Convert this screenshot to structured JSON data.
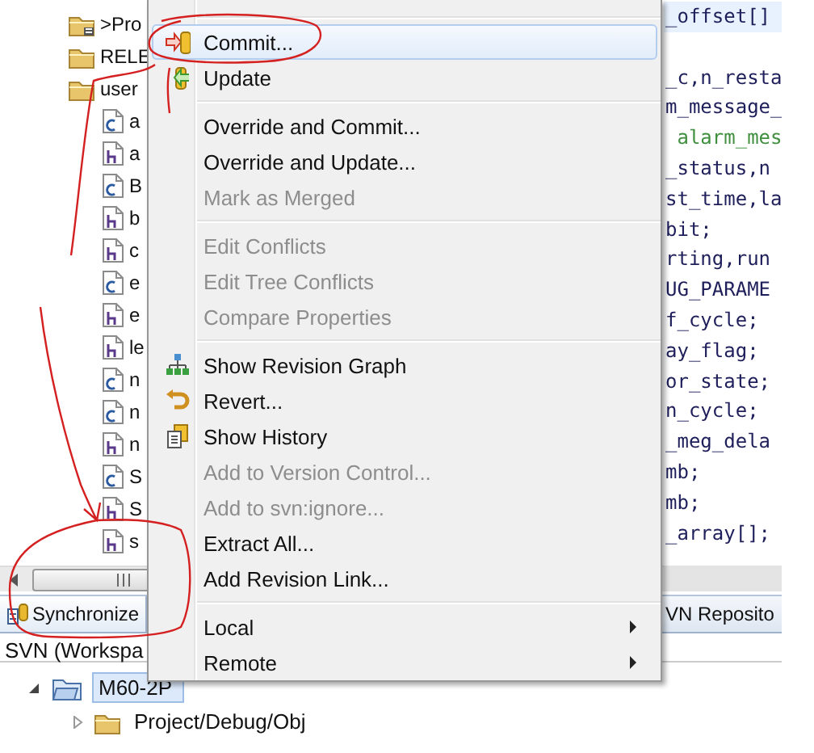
{
  "tree": {
    "items": [
      {
        "label": ">Pro",
        "kind": "folder-modified"
      },
      {
        "label": "RELE",
        "kind": "folder"
      },
      {
        "label": "user",
        "kind": "folder",
        "children": [
          {
            "label": "a",
            "kind": "c"
          },
          {
            "label": "a",
            "kind": "h"
          },
          {
            "label": "B",
            "kind": "c"
          },
          {
            "label": "b",
            "kind": "h"
          },
          {
            "label": "c",
            "kind": "h"
          },
          {
            "label": "e",
            "kind": "c"
          },
          {
            "label": "e",
            "kind": "h"
          },
          {
            "label": "le",
            "kind": "h"
          },
          {
            "label": "n",
            "kind": "c"
          },
          {
            "label": "n",
            "kind": "c"
          },
          {
            "label": "n",
            "kind": "h"
          },
          {
            "label": "S",
            "kind": "c"
          },
          {
            "label": "S",
            "kind": "h"
          },
          {
            "label": "s",
            "kind": "h"
          }
        ]
      }
    ]
  },
  "editor": {
    "lines": [
      {
        "kind": "code",
        "text": "_offset[]",
        "current": true
      },
      {
        "kind": "blank",
        "current": false
      },
      {
        "kind": "code",
        "text": "_c,n_resta",
        "current": false
      },
      {
        "kind": "code",
        "text": "m_message_",
        "current": false
      },
      {
        "kind": "comment",
        "text": " alarm_mes",
        "current": false
      },
      {
        "kind": "code",
        "text": "_status,n",
        "current": false
      },
      {
        "kind": "code",
        "text": "st_time,la",
        "current": false
      },
      {
        "kind": "code",
        "text": "bit;",
        "current": false
      },
      {
        "kind": "code",
        "text": "rting,run",
        "current": false
      },
      {
        "kind": "code",
        "text": "UG_PARAME",
        "current": false
      },
      {
        "kind": "code",
        "text": "f_cycle;",
        "current": false
      },
      {
        "kind": "code",
        "text": "ay_flag;",
        "current": false
      },
      {
        "kind": "code",
        "text": "or_state;",
        "current": false
      },
      {
        "kind": "code",
        "text": "n_cycle;",
        "current": false
      },
      {
        "kind": "code",
        "text": "_meg_dela",
        "current": false
      },
      {
        "kind": "code",
        "text": "mb;",
        "current": false
      },
      {
        "kind": "code",
        "text": "mb;",
        "current": false
      },
      {
        "kind": "code",
        "text": "_array[];",
        "current": false
      }
    ]
  },
  "tabs": [
    {
      "label": "Synchronize",
      "selected": true
    },
    {
      "label": "VN Reposito",
      "selected": false
    }
  ],
  "sync_view": {
    "title": "SVN (Workspa",
    "items": [
      {
        "label": "M60-2P",
        "selected": true,
        "expanded": true,
        "children": [
          {
            "label": "Project/Debug/Obj",
            "selected": false,
            "expanded": false
          }
        ]
      }
    ]
  },
  "context_menu": {
    "items": [
      {
        "kind": "separator"
      },
      {
        "kind": "commit",
        "label": "Commit...",
        "selected": true,
        "disabled": false,
        "submenu": false
      },
      {
        "kind": "update",
        "label": "Update",
        "selected": false,
        "disabled": false,
        "submenu": false
      },
      {
        "kind": "separator"
      },
      {
        "kind": "plain",
        "label": "Override and Commit...",
        "selected": false,
        "disabled": false,
        "submenu": false
      },
      {
        "kind": "plain",
        "label": "Override and Update...",
        "selected": false,
        "disabled": false,
        "submenu": false
      },
      {
        "kind": "plain",
        "label": "Mark as Merged",
        "selected": false,
        "disabled": true,
        "submenu": false
      },
      {
        "kind": "separator"
      },
      {
        "kind": "plain",
        "label": "Edit Conflicts",
        "selected": false,
        "disabled": true,
        "submenu": false
      },
      {
        "kind": "plain",
        "label": "Edit Tree Conflicts",
        "selected": false,
        "disabled": true,
        "submenu": false
      },
      {
        "kind": "plain",
        "label": "Compare Properties",
        "selected": false,
        "disabled": true,
        "submenu": false
      },
      {
        "kind": "separator"
      },
      {
        "kind": "graph",
        "label": "Show Revision Graph",
        "selected": false,
        "disabled": false,
        "submenu": false
      },
      {
        "kind": "revert",
        "label": "Revert...",
        "selected": false,
        "disabled": false,
        "submenu": false
      },
      {
        "kind": "history",
        "label": "Show History",
        "selected": false,
        "disabled": false,
        "submenu": false
      },
      {
        "kind": "plain",
        "label": "Add to Version Control...",
        "selected": false,
        "disabled": true,
        "submenu": false
      },
      {
        "kind": "plain",
        "label": "Add to svn:ignore...",
        "selected": false,
        "disabled": true,
        "submenu": false
      },
      {
        "kind": "plain",
        "label": "Extract All...",
        "selected": false,
        "disabled": false,
        "submenu": false
      },
      {
        "kind": "plain",
        "label": "Add Revision Link...",
        "selected": false,
        "disabled": false,
        "submenu": false
      },
      {
        "kind": "separator"
      },
      {
        "kind": "plain",
        "label": "Local",
        "selected": false,
        "disabled": false,
        "submenu": true
      },
      {
        "kind": "plain",
        "label": "Remote",
        "selected": false,
        "disabled": false,
        "submenu": true
      }
    ]
  }
}
